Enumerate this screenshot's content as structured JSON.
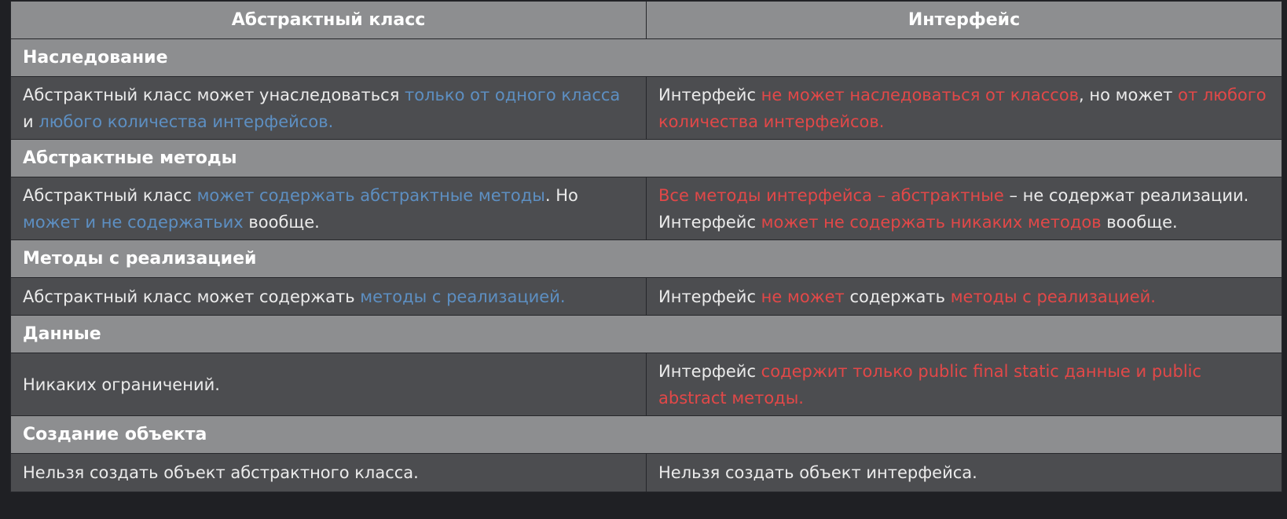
{
  "table": {
    "headers": {
      "left": "Абстрактный класс",
      "right": "Интерфейс"
    },
    "sections": [
      {
        "title": "Наследование",
        "left": {
          "s1": "Абстрактный класс может унаследоваться ",
          "s2": "только от одного класса",
          "s3": " и ",
          "s4": "любого количества интерфейсов."
        },
        "right": {
          "s1": "Интерфейс ",
          "s2": "не может наследоваться от классов",
          "s3": ", но может ",
          "s4": "от любого количества интерфейсов."
        }
      },
      {
        "title": "Абстрактные методы",
        "left": {
          "s1": "Абстрактный класс ",
          "s2": "может содержать абстрактные методы",
          "s3": ". Но ",
          "s4": "может и не содержатьих",
          "s5": " вообще."
        },
        "right": {
          "s1": "Все методы интерфейса – абстрактные",
          "s2": " – не содержат реализации. Интерфейс ",
          "s3": "может не содержать никаких методов",
          "s4": " вообще."
        }
      },
      {
        "title": "Методы с реализацией",
        "left": {
          "s1": "Абстрактный класс может содержать ",
          "s2": "методы с реализацией."
        },
        "right": {
          "s1": "Интерфейс ",
          "s2": "не может",
          "s3": " содержать ",
          "s4": "методы с реализацией."
        }
      },
      {
        "title": "Данные",
        "left": {
          "s1": "Никаких ограничений."
        },
        "right": {
          "s1": "Интерфейс ",
          "s2": "содержит только public final static данные и public abstract методы."
        }
      },
      {
        "title": "Создание объекта",
        "left": {
          "s1": "Нельзя создать объект абстрактного класса."
        },
        "right": {
          "s1": "Нельзя создать объект интерфейса."
        }
      }
    ]
  },
  "colors": {
    "page_background": "#1f2024",
    "header_background": "#8d8e90",
    "cell_background": "#4c4d50",
    "abstract_class_highlight": "#5d8fc2",
    "interface_highlight": "#e24848"
  }
}
